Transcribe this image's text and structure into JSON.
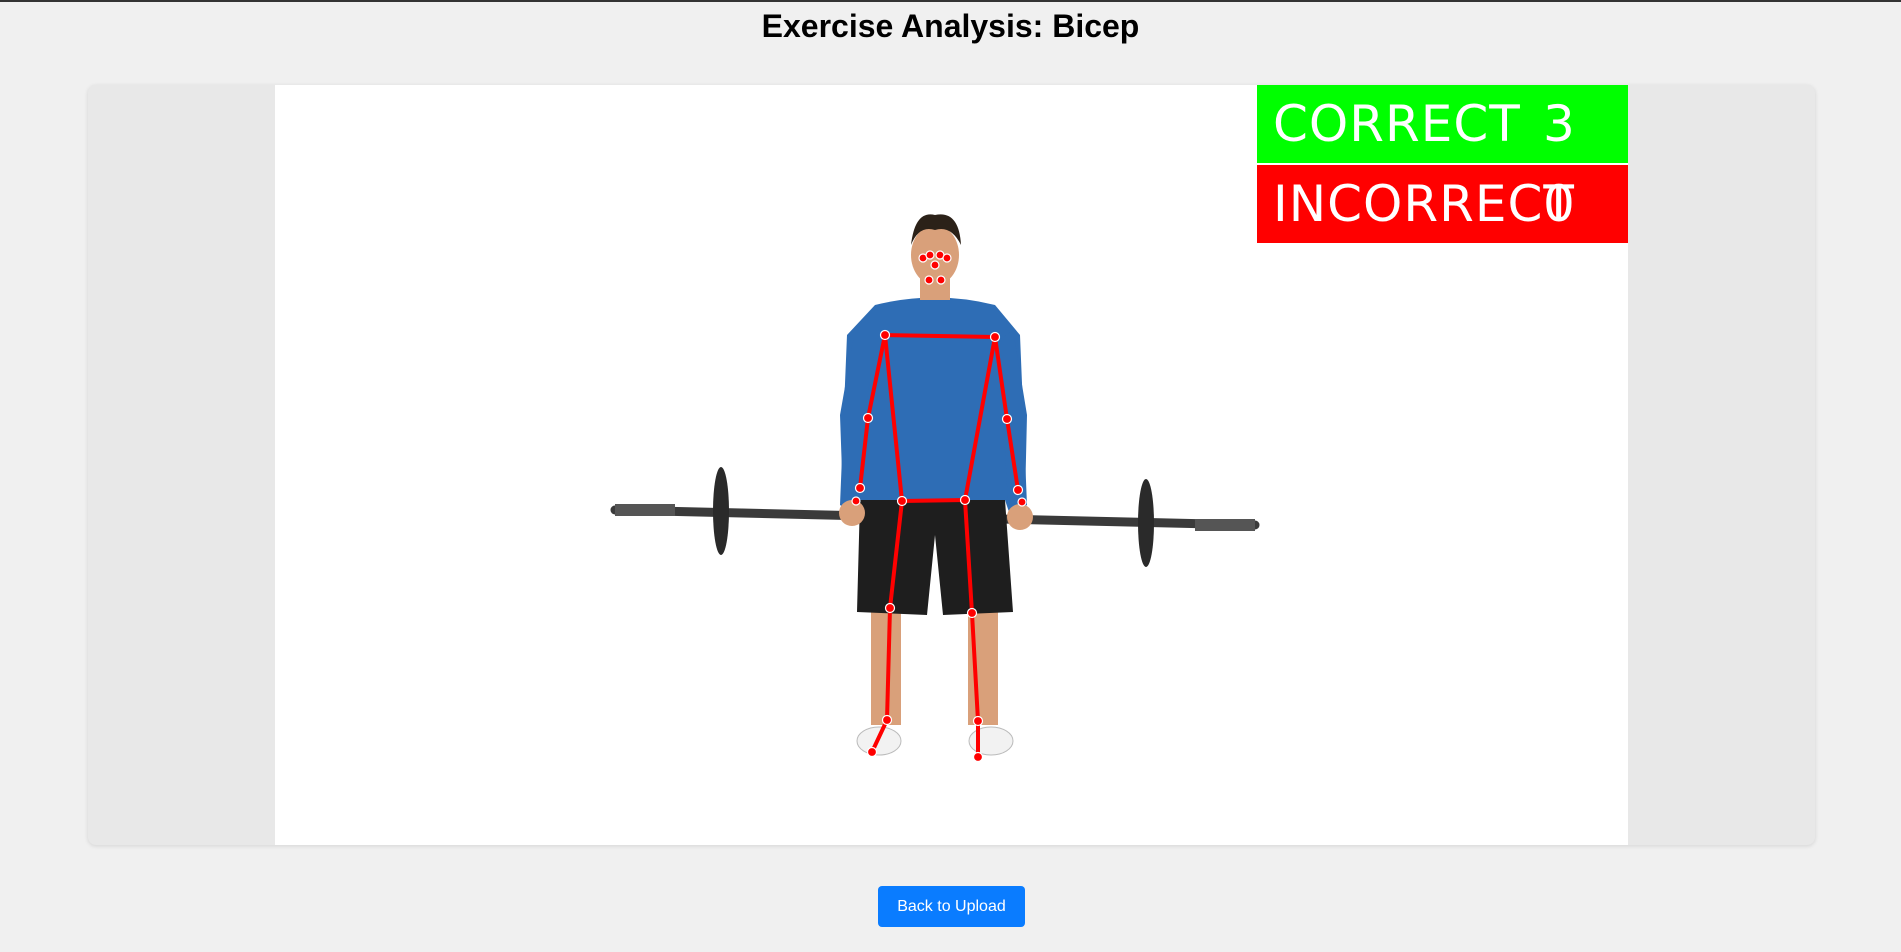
{
  "page": {
    "title": "Exercise Analysis: Bicep"
  },
  "video": {
    "counters": {
      "correct_label": "CORRECT",
      "correct_value": "3",
      "incorrect_label": "INCORRECT",
      "incorrect_value": "0"
    },
    "colors": {
      "correct_bg": "#00ff00",
      "incorrect_bg": "#ff0000",
      "skeleton": "#ff0000"
    }
  },
  "actions": {
    "back_label": "Back to Upload"
  },
  "colors": {
    "accent": "#0a7cff",
    "background": "#f0f0f0"
  }
}
